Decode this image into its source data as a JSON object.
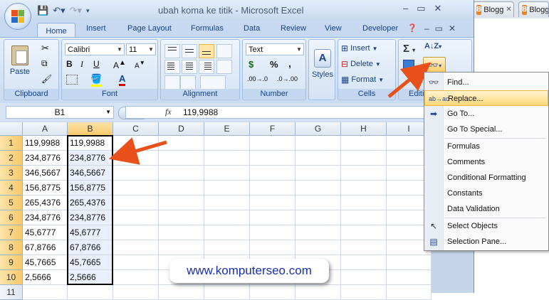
{
  "window": {
    "title": "ubah koma ke titik - Microsoft Excel",
    "controls": [
      "–",
      "▭",
      "✕"
    ]
  },
  "browser_tabs": [
    {
      "label": "Blogg"
    },
    {
      "label": "Blogg"
    }
  ],
  "ribbon": {
    "tabs": [
      "Home",
      "Insert",
      "Page Layout",
      "Formulas",
      "Data",
      "Review",
      "View",
      "Developer"
    ],
    "active_tab": "Home",
    "groups": {
      "clipboard": {
        "label": "Clipboard",
        "paste": "Paste"
      },
      "font": {
        "label": "Font",
        "font_name": "Calibri",
        "font_size": "11"
      },
      "alignment": {
        "label": "Alignment"
      },
      "number": {
        "label": "Number",
        "format": "Text",
        "currency": "$",
        "percent": "%",
        "comma": ",",
        "inc_dec": ".00→.0",
        "dec_dec": ".0→.00"
      },
      "styles": {
        "label": "Styles"
      },
      "cells": {
        "label": "Cells",
        "insert": "Insert",
        "delete": "Delete",
        "format": "Format"
      },
      "editing": {
        "label": "Editi"
      }
    }
  },
  "formula_bar": {
    "name_box": "B1",
    "fx": "fx",
    "value": "119,9988"
  },
  "grid": {
    "columns": [
      "A",
      "B",
      "C",
      "D",
      "E",
      "F",
      "G",
      "H",
      "I"
    ],
    "rows": [
      "1",
      "2",
      "3",
      "4",
      "5",
      "6",
      "7",
      "8",
      "9",
      "10",
      "11"
    ],
    "col_a": [
      "119,9988",
      "234,8776",
      "346,5667",
      "156,8775",
      "265,4376",
      "234,8776",
      "45,6777",
      "67,8766",
      "45,7665",
      "2,5666",
      ""
    ],
    "col_b": [
      "119,9988",
      "234,8776",
      "346,5667",
      "156,8775",
      "265,4376",
      "234,8776",
      "45,6777",
      "67,8766",
      "45,7665",
      "2,5666",
      ""
    ]
  },
  "find_menu": {
    "items": [
      {
        "label": "Find...",
        "icon": "binoculars-icon"
      },
      {
        "label": "Replace...",
        "icon": "replace-icon"
      },
      {
        "label": "Go To...",
        "icon": "arrow-right-icon"
      },
      {
        "label": "Go To Special..."
      },
      {
        "label": "Formulas"
      },
      {
        "label": "Comments"
      },
      {
        "label": "Conditional Formatting"
      },
      {
        "label": "Constants"
      },
      {
        "label": "Data Validation"
      },
      {
        "label": "Select Objects",
        "icon": "cursor-icon"
      },
      {
        "label": "Selection Pane...",
        "icon": "selection-pane-icon"
      }
    ]
  },
  "watermark": "www.komputerseo.com",
  "colors": {
    "arrow": "#e8501c",
    "link": "#1a2fb0",
    "highlight": "#ffd978"
  }
}
